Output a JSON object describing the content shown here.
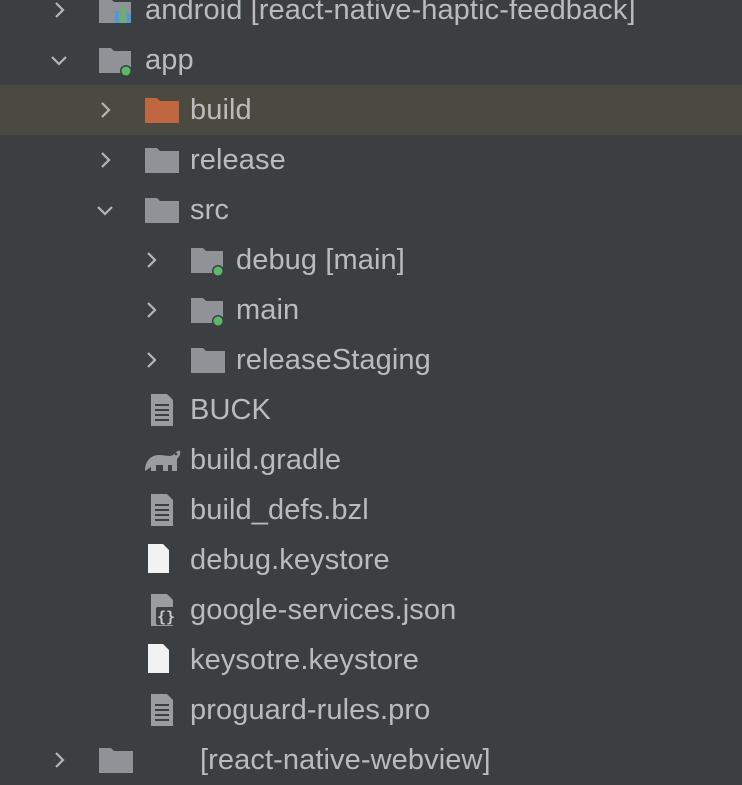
{
  "tree": {
    "rows": [
      {
        "label": "android [react-native-haptic-feedback]",
        "expanded": false,
        "icon": "android-module-icon"
      },
      {
        "label": "app",
        "expanded": true,
        "icon": "module-folder-icon"
      },
      {
        "label": "build",
        "expanded": false,
        "icon": "excluded-folder-icon",
        "selected": true
      },
      {
        "label": "release",
        "expanded": false,
        "icon": "folder-icon"
      },
      {
        "label": "src",
        "expanded": true,
        "icon": "folder-icon"
      },
      {
        "label": "debug",
        "suffix": "[main]",
        "expanded": false,
        "icon": "source-set-folder-icon"
      },
      {
        "label": "main",
        "expanded": false,
        "icon": "source-set-folder-icon"
      },
      {
        "label": "releaseStaging",
        "expanded": false,
        "icon": "folder-icon"
      },
      {
        "label": "BUCK",
        "icon": "text-file-icon"
      },
      {
        "label": "build.gradle",
        "icon": "gradle-icon"
      },
      {
        "label": "build_defs.bzl",
        "icon": "text-file-icon"
      },
      {
        "label": "debug.keystore",
        "icon": "blank-file-icon"
      },
      {
        "label": "google-services.json",
        "icon": "json-file-icon"
      },
      {
        "label": "keysotre.keystore",
        "icon": "blank-file-icon"
      },
      {
        "label": "proguard-rules.pro",
        "icon": "text-file-icon"
      },
      {
        "label": "[react-native-webview]",
        "expanded": false,
        "icon": "folder-icon"
      }
    ]
  },
  "colors": {
    "background": "#3c3f41",
    "selection": "#4b4a40",
    "text": "#bbbbbb",
    "folder": "#8f9397",
    "excluded_folder": "#c1673f",
    "module_dot": "#5fb869"
  }
}
